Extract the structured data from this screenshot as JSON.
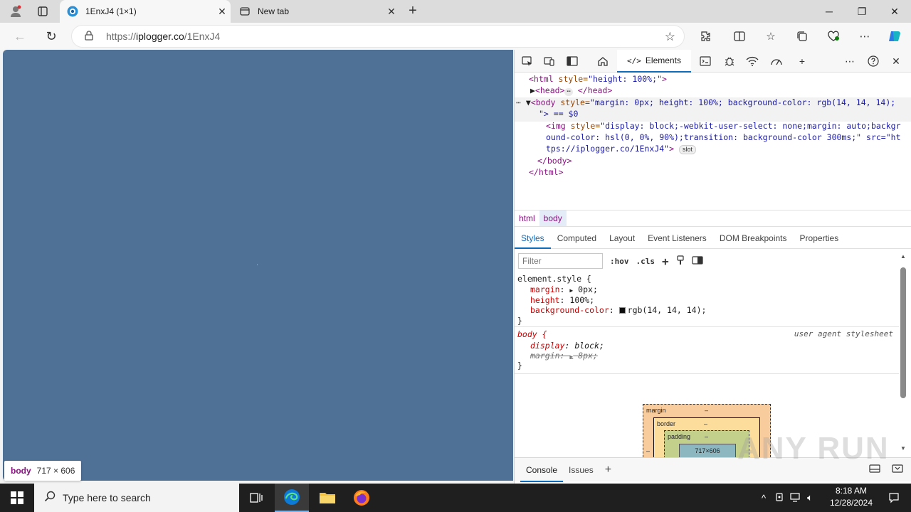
{
  "browser": {
    "tabs": [
      {
        "title": "1EnxJ4 (1×1)",
        "active": true,
        "icon": "iplogger-favicon-icon"
      },
      {
        "title": "New tab",
        "active": false,
        "icon": "newtab-page-icon"
      }
    ],
    "address": {
      "scheme": "https://",
      "host": "iplogger.co",
      "path": "/1EnxJ4"
    }
  },
  "page": {
    "background": "#4f7196",
    "tooltip": {
      "tag": "body",
      "dims": "717 × 606"
    }
  },
  "devtools": {
    "active_tab": "Elements",
    "dom": {
      "line1_tag": "<html",
      "line1_attr": " style=",
      "line1_val": "\"height: 100%;\"",
      "line1_end": ">",
      "line2_open": "<head>",
      "line2_close": "</head>",
      "line3_tag": "<body",
      "line3_attr": " style=",
      "line3_val": "\"margin: 0px; height: 100%; background-color: rgb(14, 14, 14);",
      "line4": "\"> == $0",
      "line5_tag": "<img",
      "line5_attr": " style=",
      "line5_val": "\"display: block;-webkit-user-select: none;margin: auto;backgr",
      "line6": "ound-color: hsl(0, 0%, 90%);transition: background-color 300ms;\" src=\"ht",
      "line7_val": "tps://iplogger.co/1EnxJ4\"",
      "line7_end": ">",
      "slot_badge": "slot",
      "line8": "</body>",
      "line9": "</html>"
    },
    "breadcrumbs": [
      "html",
      "body"
    ],
    "style_tabs": [
      "Styles",
      "Computed",
      "Layout",
      "Event Listeners",
      "DOM Breakpoints",
      "Properties"
    ],
    "filter_placeholder": "Filter",
    "hov": ":hov",
    "cls": ".cls",
    "element_style": {
      "selector": "element.style {",
      "props": [
        {
          "name": "margin",
          "value": "0px;"
        },
        {
          "name": "height",
          "value": "100%;"
        },
        {
          "name": "background-color",
          "value": "rgb(14, 14, 14);"
        }
      ],
      "close": "}"
    },
    "ua_rule": {
      "selector": "body {",
      "note": "user agent stylesheet",
      "props": [
        {
          "name": "display",
          "value": "block;"
        },
        {
          "name": "margin",
          "value": "8px;"
        }
      ],
      "close": "}"
    },
    "box_model": {
      "margin": "margin",
      "border": "border",
      "padding": "padding",
      "content": "717×606",
      "dash": "–"
    },
    "drawer_tabs": [
      "Console",
      "Issues"
    ]
  },
  "watermark": "ANY RUN",
  "taskbar": {
    "search_placeholder": "Type here to search",
    "time": "8:18 AM",
    "date": "12/28/2024"
  },
  "colors": {
    "accent": "#0f6cbd",
    "page_bg": "#4f7196",
    "taskbar": "#1f1f1f"
  }
}
